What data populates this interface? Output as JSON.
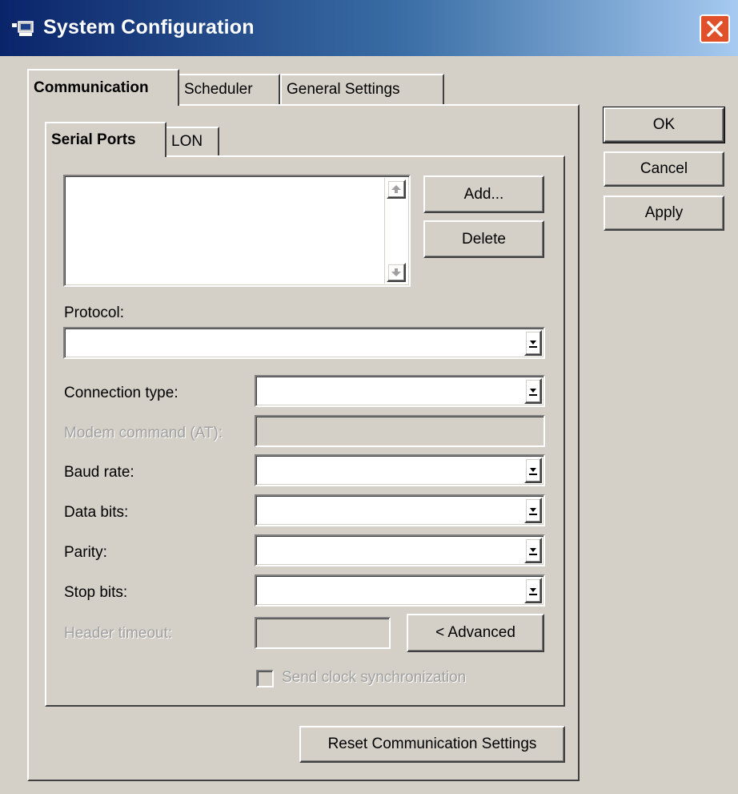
{
  "window": {
    "title": "System Configuration",
    "icon": "network-computer-icon",
    "close_icon": "close-icon"
  },
  "tabs": [
    {
      "label": "Communication",
      "active": true
    },
    {
      "label": "Scheduler",
      "active": false
    },
    {
      "label": "General Settings",
      "active": false
    }
  ],
  "subtabs": [
    {
      "label": "Serial Ports",
      "active": true
    },
    {
      "label": "LON",
      "active": false
    }
  ],
  "ports_list": {
    "items": [],
    "scroll_up_icon": "scroll-up-icon",
    "scroll_down_icon": "scroll-down-icon"
  },
  "buttons": {
    "add": "Add...",
    "delete": "Delete",
    "advanced": "< Advanced",
    "reset": "Reset Communication Settings",
    "ok": "OK",
    "cancel": "Cancel",
    "apply": "Apply"
  },
  "fields": {
    "protocol": {
      "label": "Protocol:",
      "value": ""
    },
    "connection_type": {
      "label": "Connection type:",
      "value": ""
    },
    "modem_command": {
      "label": "Modem command (AT):",
      "value": "",
      "disabled": true
    },
    "baud_rate": {
      "label": "Baud rate:",
      "value": ""
    },
    "data_bits": {
      "label": "Data bits:",
      "value": ""
    },
    "parity": {
      "label": "Parity:",
      "value": ""
    },
    "stop_bits": {
      "label": "Stop bits:",
      "value": ""
    },
    "header_timeout": {
      "label": "Header timeout:",
      "value": "",
      "disabled": true
    }
  },
  "checkbox": {
    "send_clock_sync": {
      "label": "Send clock synchronization",
      "checked": false,
      "disabled": true
    }
  },
  "colors": {
    "titlebar_start": "#0a246a",
    "titlebar_end": "#a6caf0",
    "face": "#d4d0c8",
    "close": "#e0502a"
  }
}
